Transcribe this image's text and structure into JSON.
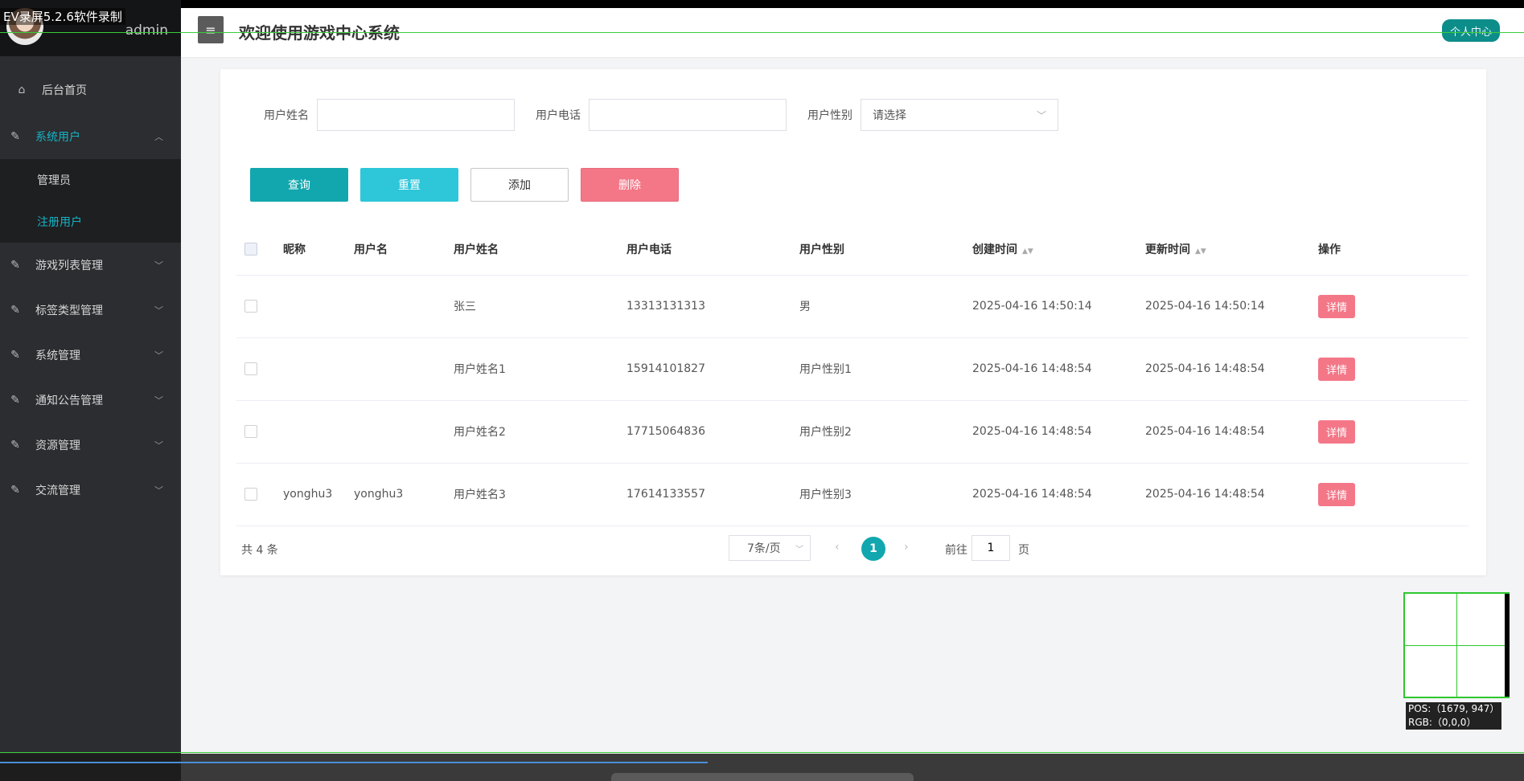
{
  "recorder": {
    "title": "EV录屏5.2.6软件录制",
    "magnifier_pos": "POS:（1679, 947）",
    "magnifier_rgb": "RGB:（0,0,0）"
  },
  "sidebar": {
    "user_name": "admin",
    "home": "后台首页",
    "groups": [
      {
        "label": "系统用户",
        "sub": [
          "管理员",
          "注册用户"
        ]
      },
      {
        "label": "游戏列表管理"
      },
      {
        "label": "标签类型管理"
      },
      {
        "label": "系统管理"
      },
      {
        "label": "通知公告管理"
      },
      {
        "label": "资源管理"
      },
      {
        "label": "交流管理"
      }
    ]
  },
  "header": {
    "menu_icon": "≡",
    "title": "欢迎使用游戏中心系统",
    "personal_center": "个人中心"
  },
  "filters": {
    "name_label": "用户姓名",
    "name_value": "",
    "phone_label": "用户电话",
    "phone_value": "",
    "gender_label": "用户性别",
    "gender_placeholder": "请选择"
  },
  "buttons": {
    "query": "查询",
    "reset": "重置",
    "add": "添加",
    "delete": "删除"
  },
  "table": {
    "headers": [
      "昵称",
      "用户名",
      "用户姓名",
      "用户电话",
      "用户性别",
      "创建时间",
      "更新时间",
      "操作"
    ],
    "rows": [
      {
        "nickname": "",
        "username": "",
        "realname": "张三",
        "phone": "13313131313",
        "gender": "男",
        "created": "2025-04-16 14:50:14",
        "updated": "2025-04-16 14:50:14",
        "action": "详情"
      },
      {
        "nickname": "",
        "username": "",
        "realname": "用户姓名1",
        "phone": "15914101827",
        "gender": "用户性别1",
        "created": "2025-04-16 14:48:54",
        "updated": "2025-04-16 14:48:54",
        "action": "详情"
      },
      {
        "nickname": "",
        "username": "",
        "realname": "用户姓名2",
        "phone": "17715064836",
        "gender": "用户性别2",
        "created": "2025-04-16 14:48:54",
        "updated": "2025-04-16 14:48:54",
        "action": "详情"
      },
      {
        "nickname": "yonghu3",
        "username": "yonghu3",
        "realname": "用户姓名3",
        "phone": "17614133557",
        "gender": "用户性别3",
        "created": "2025-04-16 14:48:54",
        "updated": "2025-04-16 14:48:54",
        "action": "详情"
      }
    ]
  },
  "pagination": {
    "total": "共 4 条",
    "page_size": "7条/页",
    "current_page": "1",
    "goto_label": "前往",
    "goto_value": "1",
    "goto_unit": "页"
  },
  "colors": {
    "accent": "#12a7ae",
    "sidebar_bg": "#2b2d30",
    "danger": "#f47788"
  }
}
